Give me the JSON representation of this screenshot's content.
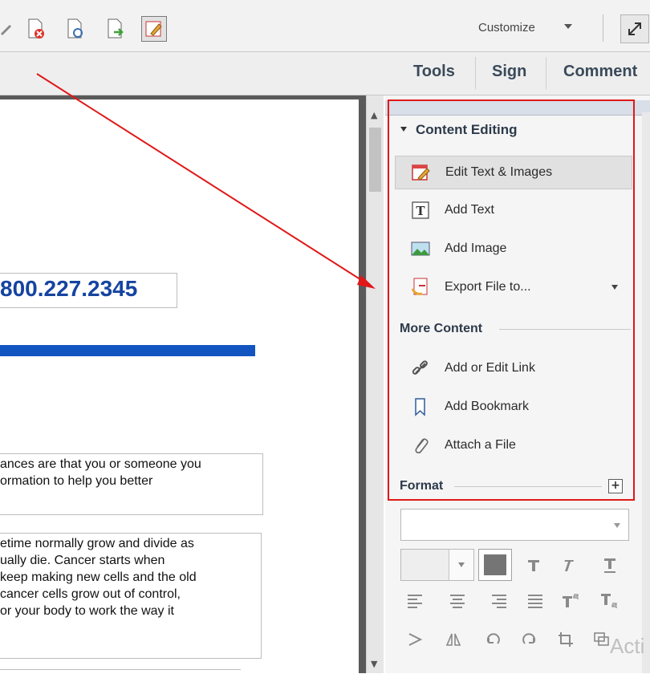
{
  "toolbar": {
    "customize_label": "Customize"
  },
  "tabs": [
    {
      "label": "Tools"
    },
    {
      "label": "Sign"
    },
    {
      "label": "Comment"
    }
  ],
  "document": {
    "phone": "800.227.2345",
    "paragraph1": "ances are that you or someone you\normation to help you better",
    "paragraph2": "etime normally grow and divide as\nually die. Cancer starts when\nkeep making new cells and the old\ncancer cells grow out of control,\nor your body to work the way it"
  },
  "panel": {
    "section_title": "Content Editing",
    "content_items": [
      {
        "label": "Edit Text & Images",
        "icon": "edit-text-images-icon"
      },
      {
        "label": "Add Text",
        "icon": "add-text-icon"
      },
      {
        "label": "Add Image",
        "icon": "add-image-icon"
      },
      {
        "label": "Export File to...",
        "icon": "export-file-icon"
      }
    ],
    "more_content_title": "More Content",
    "more_items": [
      {
        "label": "Add or Edit Link",
        "icon": "link-icon"
      },
      {
        "label": "Add Bookmark",
        "icon": "bookmark-icon"
      },
      {
        "label": "Attach a File",
        "icon": "paperclip-icon"
      }
    ],
    "format_title": "Format",
    "plus_symbol": "+"
  },
  "watermark": "Acti",
  "colors": {
    "annotation_red": "#e01818",
    "phone_blue": "#1544a0",
    "rule_blue": "#1255c0"
  }
}
